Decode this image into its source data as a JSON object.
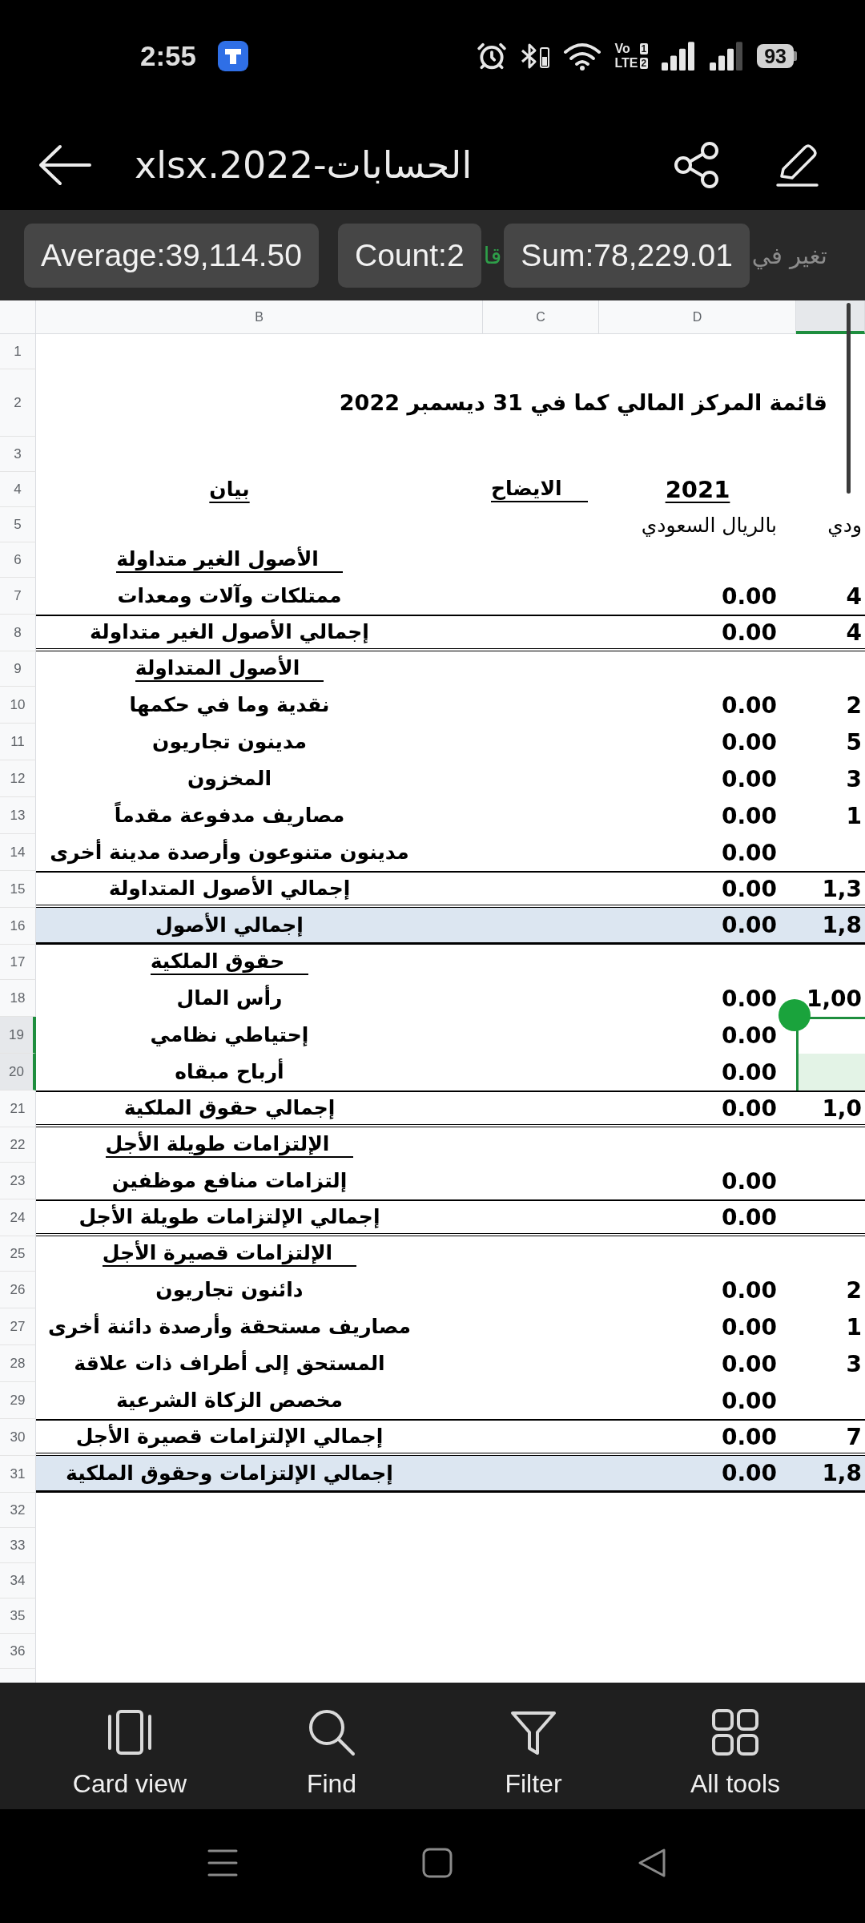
{
  "status_bar": {
    "time": "2:55",
    "network_type": [
      "Vo",
      "LTE"
    ],
    "sim_slots": [
      "1",
      "2"
    ],
    "battery": "93"
  },
  "header": {
    "title": "الحسابات-2022.xlsx"
  },
  "selection_summary": [
    "Sum:78,229.01",
    "Count:2",
    "Average:39,114.50"
  ],
  "sheet_tabs": [
    {
      "label": "تغير في",
      "selected": false
    },
    {
      "label": "قا",
      "selected": true
    }
  ],
  "sheet": {
    "columns": [
      {
        "selected": true
      },
      {
        "label": "D",
        "selected": false
      },
      {
        "label": "C",
        "selected": false
      },
      {
        "label": "B",
        "selected": false
      }
    ],
    "rows": [
      {
        "number": "1",
        "kind": "empty",
        "selected": false
      },
      {
        "number": "2",
        "kind": "title",
        "selected": false,
        "cells": {
          "B": "قائمة المركز المالي كما في 31 ديسمبر 2022"
        }
      },
      {
        "number": "3",
        "kind": "empty",
        "selected": false
      },
      {
        "number": "4",
        "kind": "heading",
        "selected": false,
        "cells": {
          "B": "بيان",
          "C": "الايضاح",
          "D": "2021"
        }
      },
      {
        "number": "5",
        "kind": "plain",
        "selected": false,
        "cells": {
          "D": "بالريال السعودي",
          "E": "ودي"
        }
      },
      {
        "number": "6",
        "kind": "section",
        "selected": false,
        "cells": {
          "B": "الأصول الغير متداولة"
        }
      },
      {
        "number": "7",
        "kind": "item",
        "selected": false,
        "cells": {
          "B": "ممتلكات وآلات ومعدات",
          "D": "0.00",
          "E": "4"
        }
      },
      {
        "number": "8",
        "kind": "total",
        "selected": false,
        "cells": {
          "B": "إجمالي الأصول الغير متداولة",
          "D": "0.00",
          "E": "4"
        }
      },
      {
        "number": "9",
        "kind": "section",
        "selected": false,
        "cells": {
          "B": "الأصول المتداولة"
        }
      },
      {
        "number": "10",
        "kind": "item",
        "selected": false,
        "cells": {
          "B": "نقدية وما في حكمها",
          "D": "0.00",
          "E": "2"
        }
      },
      {
        "number": "11",
        "kind": "item",
        "selected": false,
        "cells": {
          "B": "مدينون تجاريون",
          "D": "0.00",
          "E": "5"
        }
      },
      {
        "number": "12",
        "kind": "item",
        "selected": false,
        "cells": {
          "B": "المخزون",
          "D": "0.00",
          "E": "3"
        }
      },
      {
        "number": "13",
        "kind": "item",
        "selected": false,
        "cells": {
          "B": "مصاريف مدفوعة مقدماً",
          "D": "0.00",
          "E": "1"
        }
      },
      {
        "number": "14",
        "kind": "item",
        "selected": false,
        "cells": {
          "B": "مدينون متنوعون وأرصدة مدينة أخرى",
          "D": "0.00"
        }
      },
      {
        "number": "15",
        "kind": "total",
        "selected": false,
        "cells": {
          "B": "إجمالي الأصول المتداولة",
          "D": "0.00",
          "E": "1,3"
        }
      },
      {
        "number": "16",
        "kind": "grand_total",
        "selected": false,
        "cells": {
          "B": "إجمالي الأصول",
          "D": "0.00",
          "E": "1,8"
        }
      },
      {
        "number": "17",
        "kind": "section",
        "selected": false,
        "cells": {
          "B": "حقوق الملكية"
        }
      },
      {
        "number": "18",
        "kind": "item",
        "selected": false,
        "cells": {
          "B": "رأس المال",
          "D": "0.00",
          "E": "1,00"
        }
      },
      {
        "number": "19",
        "kind": "item",
        "selected": true,
        "cells": {
          "B": "إحتياطي نظامي",
          "D": "0.00"
        }
      },
      {
        "number": "20",
        "kind": "item",
        "selected": true,
        "cells": {
          "B": "أرباح مبقاه",
          "D": "0.00"
        }
      },
      {
        "number": "21",
        "kind": "total",
        "selected": false,
        "cells": {
          "B": "إجمالي حقوق الملكية",
          "D": "0.00",
          "E": "1,0"
        }
      },
      {
        "number": "22",
        "kind": "section",
        "selected": false,
        "cells": {
          "B": "الإلتزامات طويلة الأجل"
        }
      },
      {
        "number": "23",
        "kind": "item",
        "selected": false,
        "cells": {
          "B": "إلتزامات منافع موظفين",
          "D": "0.00"
        }
      },
      {
        "number": "24",
        "kind": "total",
        "selected": false,
        "cells": {
          "B": "إجمالي الإلتزامات طويلة الأجل",
          "D": "0.00"
        }
      },
      {
        "number": "25",
        "kind": "section",
        "selected": false,
        "cells": {
          "B": "الإلتزامات قصيرة الأجل"
        }
      },
      {
        "number": "26",
        "kind": "item",
        "selected": false,
        "cells": {
          "B": "دائنون تجاريون",
          "D": "0.00",
          "E": "2"
        }
      },
      {
        "number": "27",
        "kind": "item",
        "selected": false,
        "cells": {
          "B": "مصاريف مستحقة وأرصدة دائنة أخرى",
          "D": "0.00",
          "E": "1"
        }
      },
      {
        "number": "28",
        "kind": "item",
        "selected": false,
        "cells": {
          "B": "المستحق إلى أطراف ذات علاقة",
          "D": "0.00",
          "E": "3"
        }
      },
      {
        "number": "29",
        "kind": "item",
        "selected": false,
        "cells": {
          "B": "مخصص الزكاة الشرعية",
          "D": "0.00"
        }
      },
      {
        "number": "30",
        "kind": "total",
        "selected": false,
        "cells": {
          "B": "إجمالي الإلتزامات قصيرة الأجل",
          "D": "0.00",
          "E": "7"
        }
      },
      {
        "number": "31",
        "kind": "grand_total",
        "selected": false,
        "cells": {
          "B": "إجمالي الإلتزامات وحقوق الملكية",
          "D": "0.00",
          "E": "1,8"
        }
      },
      {
        "number": "32",
        "kind": "empty",
        "selected": false
      },
      {
        "number": "33",
        "kind": "empty",
        "selected": false
      },
      {
        "number": "34",
        "kind": "empty",
        "selected": false
      },
      {
        "number": "35",
        "kind": "empty",
        "selected": false
      },
      {
        "number": "36",
        "kind": "empty",
        "selected": false
      }
    ]
  },
  "toolbar": [
    "All tools",
    "Filter",
    "Find",
    "Card view"
  ]
}
